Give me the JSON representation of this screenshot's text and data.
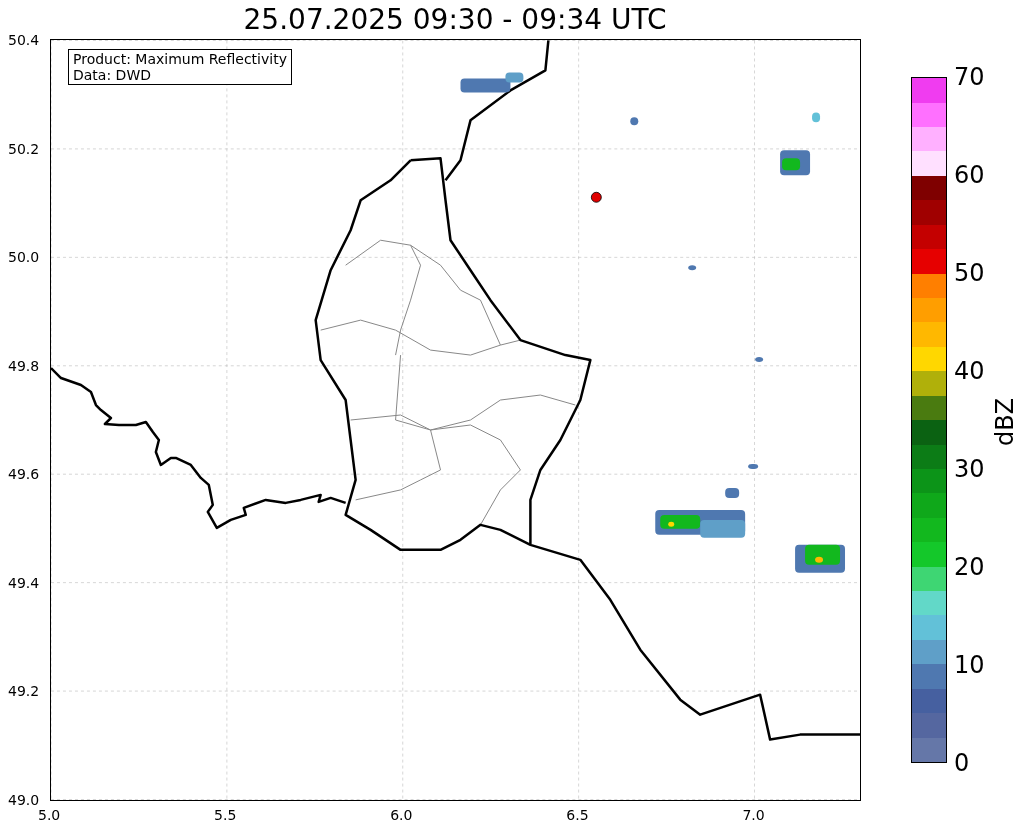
{
  "title": "25.07.2025 09:30 - 09:34 UTC",
  "legend": [
    "Product: Maximum Reflectivity",
    "Data: DWD"
  ],
  "map": {
    "y_ticks": [
      "50.4",
      "50.2",
      "50.0",
      "49.8",
      "49.6",
      "49.4",
      "49.2",
      "49.0"
    ],
    "x_ticks": [
      "5.0",
      "5.5",
      "6.0",
      "6.5",
      "7.0"
    ]
  },
  "colorbar": {
    "label": "dBZ",
    "ticks": [
      "70",
      "60",
      "50",
      "40",
      "30",
      "20",
      "10",
      "0"
    ],
    "bins": [
      {
        "color": "#6577a8"
      },
      {
        "color": "#5567a0"
      },
      {
        "color": "#4660a0"
      },
      {
        "color": "#4f78b0"
      },
      {
        "color": "#5f9fc8"
      },
      {
        "color": "#62c1d8"
      },
      {
        "color": "#62d8c8"
      },
      {
        "color": "#3ed673"
      },
      {
        "color": "#14c82a"
      },
      {
        "color": "#12b81e"
      },
      {
        "color": "#0fa81a"
      },
      {
        "color": "#0c9418"
      },
      {
        "color": "#0c7c16"
      },
      {
        "color": "#0b6212"
      },
      {
        "color": "#4a7b10"
      },
      {
        "color": "#b0b00a"
      },
      {
        "color": "#ffd700"
      },
      {
        "color": "#ffb800"
      },
      {
        "color": "#ff9e00"
      },
      {
        "color": "#ff7f00"
      },
      {
        "color": "#e60000"
      },
      {
        "color": "#c40000"
      },
      {
        "color": "#a00000"
      },
      {
        "color": "#7f0000"
      },
      {
        "color": "#ffe0ff"
      },
      {
        "color": "#ffb0ff"
      },
      {
        "color": "#ff70ff"
      },
      {
        "color": "#f03cf0"
      }
    ]
  }
}
